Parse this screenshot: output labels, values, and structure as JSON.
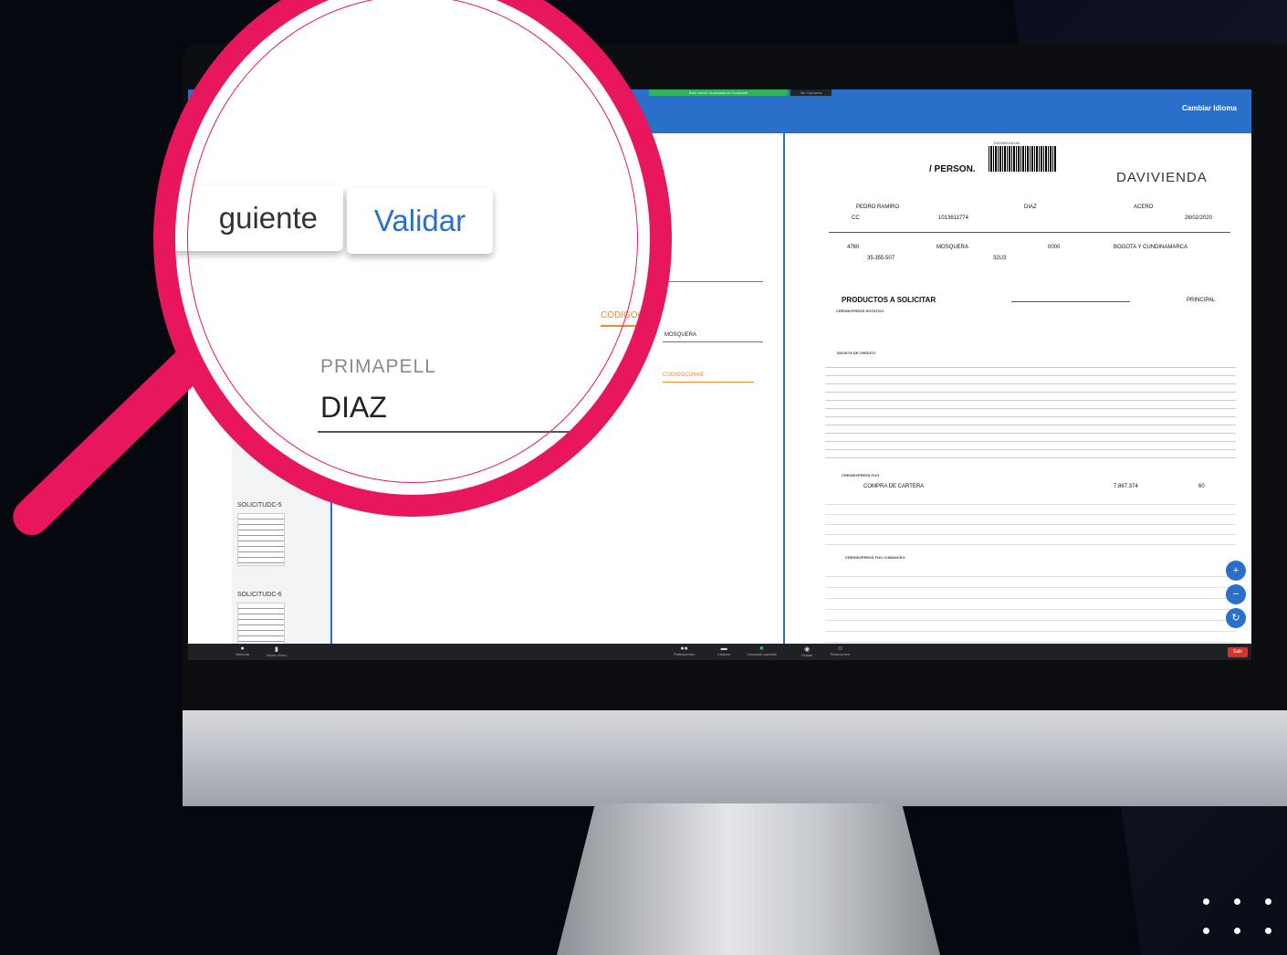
{
  "app": {
    "change_language": "Cambiar Idioma",
    "share_banner": "Está viendo la pantalla de Compartir",
    "share_options": "Ver Opciones"
  },
  "magnifier": {
    "siguiente_fragment": "guiente",
    "validar": "Validar",
    "field_label": "PRIMAPELL",
    "field_value": "DIAZ",
    "orange_field": "CODIGOCONVE"
  },
  "form": {
    "field_c_value": "C",
    "field_city_value": "MOSQUERA",
    "orange_label": "CODIGOCONVE"
  },
  "thumbnails": [
    {
      "label": "SOLICITUDC-5"
    },
    {
      "label": "SOLICITUDC-6"
    }
  ],
  "document": {
    "heading": "/ PERSON.",
    "logo": "DAVIVIENDA",
    "barcode_text": "110000004A166",
    "nombres": "PEDRO RAMIRO",
    "primer_apellido": "DIAZ",
    "segundo_apellido": "ACERO",
    "tipo_id": "CC",
    "numero_id": "1013611774",
    "fecha": "26/02/2020",
    "codigo": "4760",
    "ciudad": "MOSQUERA",
    "codigo_2": "0000",
    "region": "BOGOTA Y CUNDINAMARCA",
    "valor_1": "35.355.507",
    "valor_2": "32U3",
    "section_productos": "PRODUCTOS A SOLICITAR",
    "campana": "PRINCIPAL",
    "crediexpress_rotativo": "CREDIEXPRESS ROTATIVO",
    "tarjeta_credito": "TARJETA DE CREDITO",
    "crediexpress_fijo": "CREDIEXPRESS FIJO",
    "compra_cartera": "COMPRA DE CARTERA",
    "valor_cartera": "7.867.374",
    "plazo": "60",
    "crediexpress_fijo_cuotas": "CREDIEXPRESS FIJO CUBANCEO"
  },
  "zoom_toolbar": {
    "items": [
      {
        "label": "Silenciar",
        "icon": "microphone-icon"
      },
      {
        "label": "Iniciar Video",
        "icon": "video-icon"
      },
      {
        "label": "Participantes",
        "icon": "participants-icon"
      },
      {
        "label": "Chatear",
        "icon": "chat-icon"
      },
      {
        "label": "Compartir pantalla",
        "icon": "share-screen-icon"
      },
      {
        "label": "Grabar",
        "icon": "record-icon"
      },
      {
        "label": "Reacciones",
        "icon": "reactions-icon"
      }
    ],
    "exit": "Salir"
  },
  "colors": {
    "accent_pink": "#e8175d",
    "header_blue": "#2a6fc9",
    "share_green": "#2fb559",
    "field_orange": "#f08a24"
  }
}
